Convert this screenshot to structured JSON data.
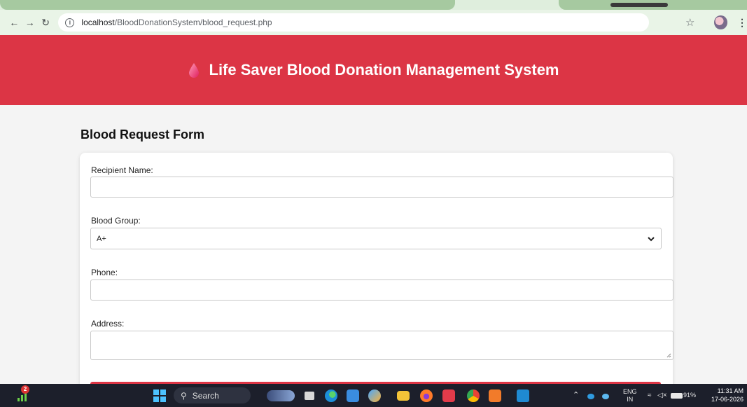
{
  "browser": {
    "url_host": "localhost",
    "url_path": "/BloodDonationSystem/blood_request.php"
  },
  "header": {
    "title": "Life Saver Blood Donation Management System"
  },
  "page": {
    "heading": "Blood Request Form"
  },
  "form": {
    "recipient_label": "Recipient Name:",
    "recipient_value": "",
    "blood_group_label": "Blood Group:",
    "blood_group_value": "A+",
    "phone_label": "Phone:",
    "phone_value": "",
    "address_label": "Address:",
    "address_value": ""
  },
  "taskbar": {
    "search_label": "Search",
    "notification_count": "2",
    "language_line1": "ENG",
    "language_line2": "IN",
    "battery": "91%",
    "time": "11:31 AM",
    "date": "17-06-2026"
  },
  "colors": {
    "brand": "#dc3545",
    "browser_toolbar": "#e9f4e7"
  }
}
